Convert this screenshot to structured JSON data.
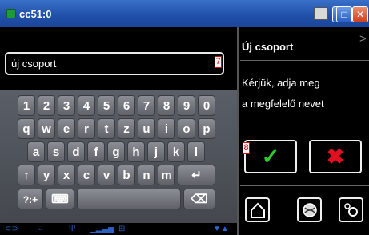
{
  "window": {
    "title": "cc51:0",
    "app_icon": "phone-icon"
  },
  "input": {
    "value": "új csoport",
    "badge": "7"
  },
  "keyboard": {
    "row1": [
      "1",
      "2",
      "3",
      "4",
      "5",
      "6",
      "7",
      "8",
      "9",
      "0"
    ],
    "row2": [
      "q",
      "w",
      "e",
      "r",
      "t",
      "z",
      "u",
      "i",
      "o",
      "p"
    ],
    "row3": [
      "a",
      "s",
      "d",
      "f",
      "g",
      "h",
      "j",
      "k",
      "l"
    ],
    "row4": [
      "y",
      "x",
      "c",
      "v",
      "b",
      "n",
      "m"
    ],
    "shift": "↑",
    "enter": "↵",
    "sym": "?:+",
    "keyboard_icon": "⌨",
    "backspace": "⌫"
  },
  "panel": {
    "title": "Új csoport",
    "message_line1": "Kérjük, adja meg",
    "message_line2": "a megfelelő nevet",
    "confirm_badge": "8",
    "confirm_icon": "✓",
    "cancel_icon": "✖",
    "accent_green": "#2ecc2e",
    "accent_red": "#e01020"
  }
}
